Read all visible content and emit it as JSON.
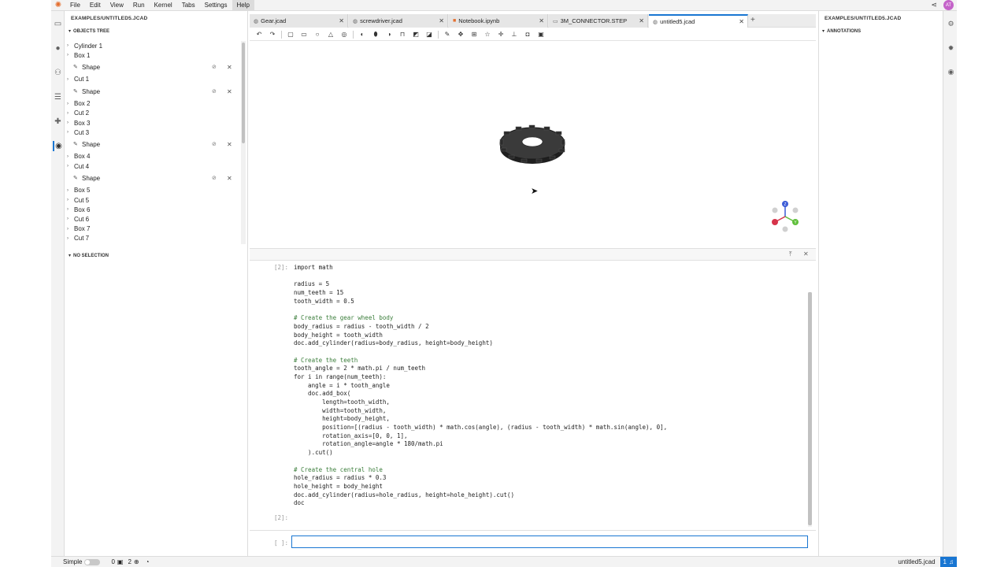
{
  "menubar": {
    "items": [
      "File",
      "Edit",
      "View",
      "Run",
      "Kernel",
      "Tabs",
      "Settings",
      "Help"
    ],
    "active": "Help",
    "avatar": "AT"
  },
  "left_panel": {
    "title": "EXAMPLES/UNTITLED5.JCAD",
    "objects_tree_label": "OBJECTS TREE",
    "no_selection_label": "NO SELECTION",
    "tree": [
      {
        "label": "Cylinder 1",
        "kind": "object"
      },
      {
        "label": "Box 1",
        "kind": "object"
      },
      {
        "label": "Shape",
        "kind": "shape"
      },
      {
        "label": "Cut 1",
        "kind": "object"
      },
      {
        "label": "Shape",
        "kind": "shape"
      },
      {
        "label": "Box 2",
        "kind": "object"
      },
      {
        "label": "Cut 2",
        "kind": "object"
      },
      {
        "label": "Box 3",
        "kind": "object"
      },
      {
        "label": "Cut 3",
        "kind": "object"
      },
      {
        "label": "Shape",
        "kind": "shape"
      },
      {
        "label": "Box 4",
        "kind": "object"
      },
      {
        "label": "Cut 4",
        "kind": "object"
      },
      {
        "label": "Shape",
        "kind": "shape"
      },
      {
        "label": "Box 5",
        "kind": "object"
      },
      {
        "label": "Cut 5",
        "kind": "object"
      },
      {
        "label": "Box 6",
        "kind": "object"
      },
      {
        "label": "Cut 6",
        "kind": "object"
      },
      {
        "label": "Box 7",
        "kind": "object"
      },
      {
        "label": "Cut 7",
        "kind": "object"
      }
    ]
  },
  "tabs": [
    {
      "label": "Gear.jcad",
      "icon": "cad-file-icon",
      "active": false
    },
    {
      "label": "screwdriver.jcad",
      "icon": "cad-file-icon",
      "active": false
    },
    {
      "label": "Notebook.ipynb",
      "icon": "notebook-icon",
      "active": false
    },
    {
      "label": "3M_CONNECTOR.STEP",
      "icon": "step-file-icon",
      "active": false
    },
    {
      "label": "untitled5.jcad",
      "icon": "cad-file-icon",
      "active": true
    }
  ],
  "console": {
    "prompt_done": "[2]:",
    "prompt_input": "[ ]:",
    "input_value": "",
    "code_lines": [
      "import math",
      "",
      "radius = 5",
      "num_teeth = 15",
      "tooth_width = 0.5",
      "",
      "# Create the gear wheel body",
      "body_radius = radius - tooth_width / 2",
      "body_height = tooth_width",
      "doc.add_cylinder(radius=body_radius, height=body_height)",
      "",
      "# Create the teeth",
      "tooth_angle = 2 * math.pi / num_teeth",
      "for i in range(num_teeth):",
      "    angle = i * tooth_angle",
      "    doc.add_box(",
      "        length=tooth_width,",
      "        width=tooth_width,",
      "        height=body_height,",
      "        position=[(radius - tooth_width) * math.cos(angle), (radius - tooth_width) * math.sin(angle), 0],",
      "        rotation_axis=[0, 0, 1],",
      "        rotation_angle=angle * 180/math.pi",
      "    ).cut()",
      "",
      "# Create the central hole",
      "hole_radius = radius * 0.3",
      "hole_height = body_height",
      "doc.add_cylinder(radius=hole_radius, height=hole_height).cut()",
      "doc"
    ]
  },
  "right_panel": {
    "title": "EXAMPLES/UNTITLED5.JCAD",
    "annotations_label": "ANNOTATIONS"
  },
  "axes_gizmo": {
    "z": "Z",
    "y": "Y"
  },
  "statusbar": {
    "mode_label": "Simple",
    "count_a": "0",
    "count_b": "2",
    "filename": "untitled5.jcad",
    "notifications": "1"
  },
  "colors": {
    "accent": "#1976d2",
    "gear": "#2b2b2b",
    "axis_z": "#3b5bd6",
    "axis_y": "#5fbf3a",
    "axis_x": "#d6334a",
    "avatar": "#c463c9"
  }
}
